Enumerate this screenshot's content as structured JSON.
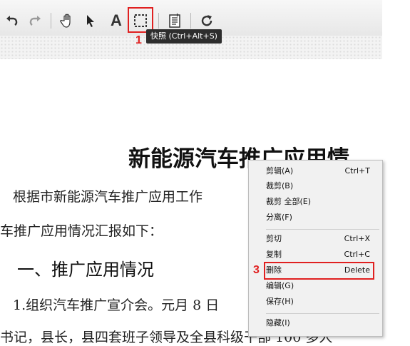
{
  "toolbar": {
    "undo_icon": "undo-icon",
    "redo_icon": "redo-icon",
    "hand_icon": "hand-tool-icon",
    "select_icon": "select-arrow-icon",
    "text_icon": "text-tool-icon",
    "snapshot_icon": "snapshot-icon",
    "page_icon": "page-icon",
    "rotate_icon": "rotate-icon",
    "text_glyph": "A"
  },
  "tooltip": {
    "text": "快照 (Ctrl+Alt+S)"
  },
  "annotations": {
    "step1": "1",
    "step3": "3",
    "color": "#e02020"
  },
  "document": {
    "title": "新能源汽车推广应用情",
    "line1": "根据市新能源汽车推广应用工作",
    "line2": "车推广应用情况汇报如下：",
    "heading": "一、推广应用情况",
    "line3": "1.组织汽车推广宣介会。元月 8 日",
    "line4": "书记，县长，县四套班子领导及全县科级干部 100 多人"
  },
  "context_menu": {
    "items": [
      {
        "label": "剪辑(A)",
        "shortcut": "Ctrl+T"
      },
      {
        "label": "裁剪(B)",
        "shortcut": ""
      },
      {
        "label": "裁剪 全部(E)",
        "shortcut": ""
      },
      {
        "label": "分离(F)",
        "shortcut": ""
      },
      {
        "label": "剪切",
        "shortcut": "Ctrl+X"
      },
      {
        "label": "复制",
        "shortcut": "Ctrl+C"
      },
      {
        "label": "删除",
        "shortcut": "Delete"
      },
      {
        "label": "编辑(G)",
        "shortcut": ""
      },
      {
        "label": "保存(H)",
        "shortcut": ""
      },
      {
        "label": "隐藏(I)",
        "shortcut": ""
      }
    ]
  }
}
